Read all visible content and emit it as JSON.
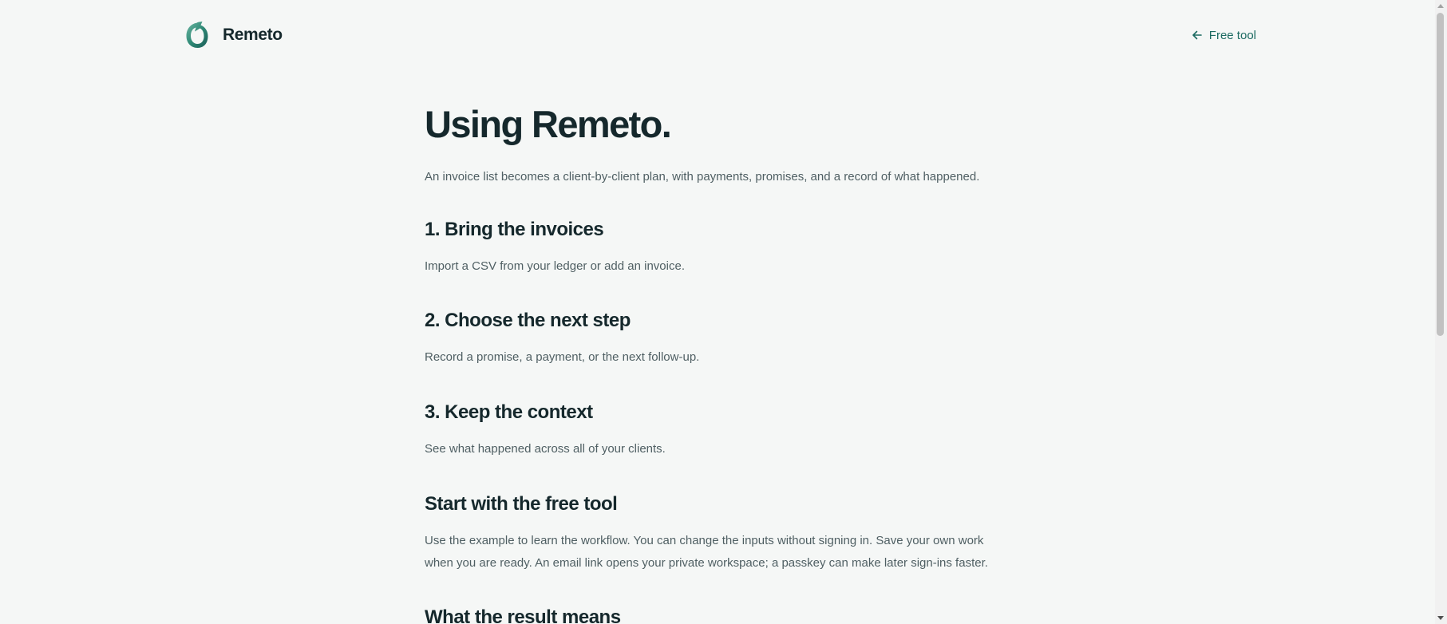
{
  "header": {
    "brand_name": "Remeto",
    "back_link_label": "Free tool",
    "logo_icon": "remeto-ring-logo",
    "back_icon": "arrow-left-icon"
  },
  "main": {
    "title": "Using Remeto.",
    "lead": "An invoice list becomes a client-by-client plan, with payments, promises, and a record of what happened.",
    "sections": [
      {
        "heading": "1. Bring the invoices",
        "body": "Import a CSV from your ledger or add an invoice."
      },
      {
        "heading": "2. Choose the next step",
        "body": "Record a promise, a payment, or the next follow-up."
      },
      {
        "heading": "3. Keep the context",
        "body": "See what happened across all of your clients."
      },
      {
        "heading": "Start with the free tool",
        "body": "Use the example to learn the workflow. You can change the inputs without signing in. Save your own work when you are ready. An email link opens your private workspace; a passkey can make later sign-ins faster."
      },
      {
        "heading": "What the result means"
      }
    ]
  },
  "colors": {
    "background": "#f5f7f6",
    "text": "#15282c",
    "muted_text": "#4f5f63",
    "accent": "#1d6b62"
  }
}
